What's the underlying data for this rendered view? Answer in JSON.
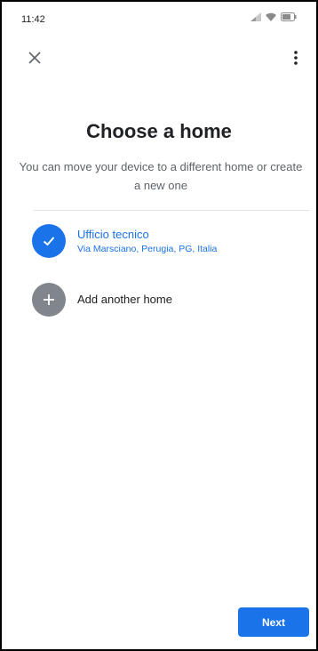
{
  "status_bar": {
    "time": "11:42",
    "icons": [
      "signal-icon",
      "wifi-icon",
      "battery-icon"
    ]
  },
  "top_bar": {
    "close_icon": "close-icon",
    "more_icon": "more-vert-icon"
  },
  "main": {
    "title": "Choose a home",
    "subtitle": "You can move your device to a different home or create a new one",
    "homes": [
      {
        "name": "Ufficio tecnico",
        "address": "Via Marsciano, Perugia, PG, Italia",
        "selected": true
      }
    ],
    "add_home_label": "Add another home"
  },
  "footer": {
    "next_label": "Next"
  },
  "colors": {
    "accent": "#1a73e8",
    "muted_icon": "#80868b",
    "text_primary": "#202124",
    "text_secondary": "#5f6368"
  }
}
